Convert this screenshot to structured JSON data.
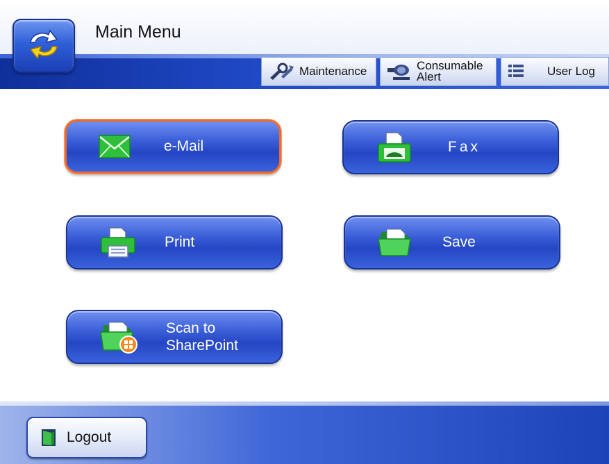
{
  "header": {
    "title": "Main Menu",
    "home_icon": "refresh-arrows-icon",
    "tabs": [
      {
        "label": "Maintenance",
        "icon": "wrench-icon"
      },
      {
        "label_line1": "Consumable",
        "label_line2": "Alert",
        "icon": "scanner-roller-icon"
      },
      {
        "label": "User Log",
        "icon": "list-icon"
      }
    ]
  },
  "menu": {
    "email": {
      "label": "e-Mail",
      "icon": "envelope-icon",
      "selected": true
    },
    "fax": {
      "label": "Fax",
      "icon": "fax-machine-icon"
    },
    "print": {
      "label": "Print",
      "icon": "printer-icon"
    },
    "save": {
      "label": "Save",
      "icon": "folder-icon"
    },
    "sharepoint": {
      "label_line1": "Scan to",
      "label_line2": "SharePoint",
      "icon": "sharepoint-folder-icon"
    }
  },
  "footer": {
    "logout_label": "Logout",
    "logout_icon": "door-icon"
  },
  "colors": {
    "button_blue": "#2f55d0",
    "selected_border": "#ee6b2b",
    "header_band": "#1f48c4"
  }
}
